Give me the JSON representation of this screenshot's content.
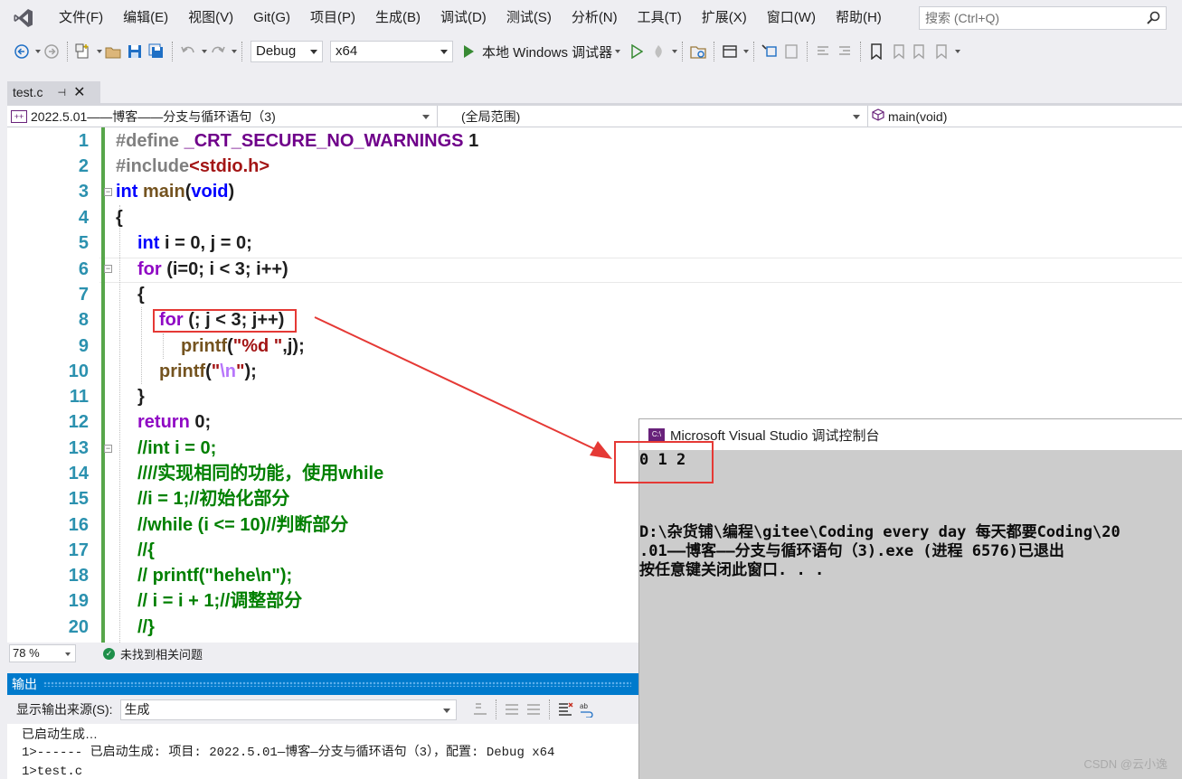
{
  "menu": [
    "文件(F)",
    "编辑(E)",
    "视图(V)",
    "Git(G)",
    "项目(P)",
    "生成(B)",
    "调试(D)",
    "测试(S)",
    "分析(N)",
    "工具(T)",
    "扩展(X)",
    "窗口(W)",
    "帮助(H)"
  ],
  "search": {
    "placeholder": "搜索 (Ctrl+Q)"
  },
  "toolbar": {
    "config": "Debug",
    "platform": "x64",
    "run_label": "本地 Windows 调试器"
  },
  "tab": {
    "filename": "test.c"
  },
  "navbar": {
    "project": "2022.5.01——博客——分支与循环语句（3)",
    "scope": "(全局范围)",
    "member": "main(void)"
  },
  "editor": {
    "line_numbers": [
      "1",
      "2",
      "3",
      "4",
      "5",
      "6",
      "7",
      "8",
      "9",
      "10",
      "11",
      "12",
      "13",
      "14",
      "15",
      "16",
      "17",
      "18",
      "19",
      "20"
    ],
    "accent_change_bar": "#57a64a",
    "highlight_color": "#e53935"
  },
  "code": {
    "l1": {
      "a": "#define ",
      "b": "_CRT_SECURE_NO_WARNINGS",
      "c": " 1"
    },
    "l2": {
      "a": "#include",
      "b": "<stdio.h>"
    },
    "l3": {
      "a": "int ",
      "b": "main",
      "c": "(",
      "d": "void",
      ">": ")"
    },
    "l4": "{",
    "l5": {
      "a": "int ",
      "b": "i = 0, ",
      "c": "j = 0;"
    },
    "l6": {
      "a": "for ",
      "b": "(i=0; i < 3; i++)"
    },
    "l7": "{",
    "l8": {
      "a": "for ",
      "b": "(; j < 3; j++)"
    },
    "l9": {
      "a": "printf",
      "b": "(",
      "c": "\"%d \"",
      "d": ",j);"
    },
    "l10": {
      "a": "printf",
      "b": "(",
      "c": "\"",
      "d": "\\n",
      "e": "\"",
      "f": ");"
    },
    "l11": "}",
    "l12": {
      "a": "return ",
      "b": "0;"
    },
    "l13": "//int i = 0;",
    "l14": "////实现相同的功能，使用while",
    "l15": "//i = 1;//初始化部分",
    "l16": "//while (i <= 10)//判断部分",
    "l17": "//{",
    "l18": "// printf(\"hehe\\n\");",
    "l19": "// i = i + 1;//调整部分",
    "l20": "//}"
  },
  "status": {
    "zoom": "78 %",
    "issues": "未找到相关问题"
  },
  "output": {
    "title": "输出",
    "source_label": "显示输出来源(S):",
    "source_value": "生成",
    "lines": [
      "已启动生成…",
      "1>------ 已启动生成: 项目: 2022.5.01—博客—分支与循环语句（3），配置: Debug x64",
      "1>test.c"
    ]
  },
  "console": {
    "title": "Microsoft Visual Studio 调试控制台",
    "icon_text": "C:\\",
    "result": "0 1 2",
    "line1": "D:\\杂货铺\\编程\\gitee\\Coding every day 每天都要Coding\\20",
    ".01——博客——分支与循环语句（3).exe (进程 6576)已退出": "",
    "line2": ".01——博客——分支与循环语句（3).exe (进程 6576)已退出",
    "line3": "按任意键关闭此窗口. . ."
  },
  "watermark": "CSDN @云小逸"
}
